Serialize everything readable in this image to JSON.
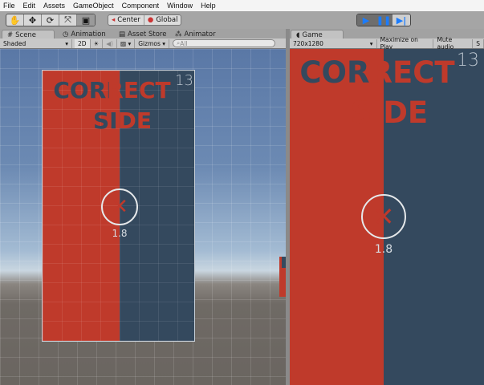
{
  "menu": [
    "File",
    "Edit",
    "Assets",
    "GameObject",
    "Component",
    "Window",
    "Help"
  ],
  "toolbar": {
    "tools": [
      "hand-icon",
      "move-icon",
      "rotate-icon",
      "scale-icon",
      "rect-icon"
    ],
    "pivot": "Center",
    "space": "Global",
    "play_controls": [
      "play-icon",
      "pause-icon",
      "step-icon"
    ]
  },
  "scene_tabs": [
    "Scene",
    "Animation",
    "Asset Store",
    "Animator"
  ],
  "scene_bar": {
    "shading": "Shaded",
    "mode2d": "2D",
    "gizmos": "Gizmos",
    "search_placeholder": "All"
  },
  "game_tab": "Game",
  "game_bar": {
    "resolution": "720x1280",
    "maximize": "Maximize on Play",
    "mute": "Mute audio",
    "stats": "S"
  },
  "game_ui": {
    "title_line1": "CORRECT",
    "title_line2": "SIDE",
    "score": "13",
    "timer": "1.8",
    "button_icon": "close-x-icon"
  },
  "colors": {
    "red": "#bf3a2b",
    "blue": "#34495e",
    "accent": "#1a7cff"
  }
}
